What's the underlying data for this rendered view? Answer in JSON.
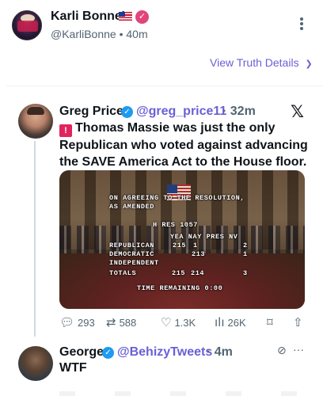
{
  "post": {
    "author": "Karli Bonne'",
    "handle_time": "@KarliBonne • 40m",
    "view_details": "View Truth Details",
    "view_details_chevron": "❯"
  },
  "quote": {
    "name": "Greg Price",
    "handle": "@greg_price11",
    "time": "· 32m",
    "x_logo": "𝕏",
    "siren": "🚨",
    "text": "Thomas Massie was just the only Republican who voted against advancing the SAVE America Act to the House floor.",
    "media": {
      "resolution_line1": "ON AGREEING TO THE RESOLUTION,",
      "resolution_line2": "AS AMENDED",
      "h_res": "H RES 1057",
      "col_header": "YEA NAY PRES NV",
      "rows": [
        {
          "party": "REPUBLICAN",
          "yea": "215",
          "nay": "1",
          "pres": "",
          "nv": "2"
        },
        {
          "party": "DEMOCRATIC",
          "yea": "",
          "nay": "213",
          "pres": "",
          "nv": "1"
        },
        {
          "party": "INDEPENDENT",
          "yea": "",
          "nay": "",
          "pres": "",
          "nv": ""
        },
        {
          "party": "TOTALS",
          "yea": "215",
          "nay": "214",
          "pres": "",
          "nv": "3"
        }
      ],
      "time_remaining": "TIME REMAINING 0:00"
    },
    "actions": {
      "replies": "293",
      "reposts": "588",
      "likes": "1.3K",
      "views": "26K"
    }
  },
  "reply": {
    "name": "George",
    "handle": "@BehizyTweets",
    "time": "· 4m",
    "text": "WTF",
    "more": "···"
  },
  "icons": [
    "more-vertical-icon",
    "flag-icon",
    "verified-badge-icon",
    "chevron-right-icon",
    "x-logo-icon",
    "siren-icon",
    "reply-icon",
    "repost-icon",
    "like-icon",
    "views-icon",
    "bookmark-icon",
    "share-icon"
  ],
  "colors": {
    "accent": "#6a60d6",
    "verified_blue": "#1d9bf0",
    "verified_pink": "#e0457b",
    "muted": "#536471"
  }
}
